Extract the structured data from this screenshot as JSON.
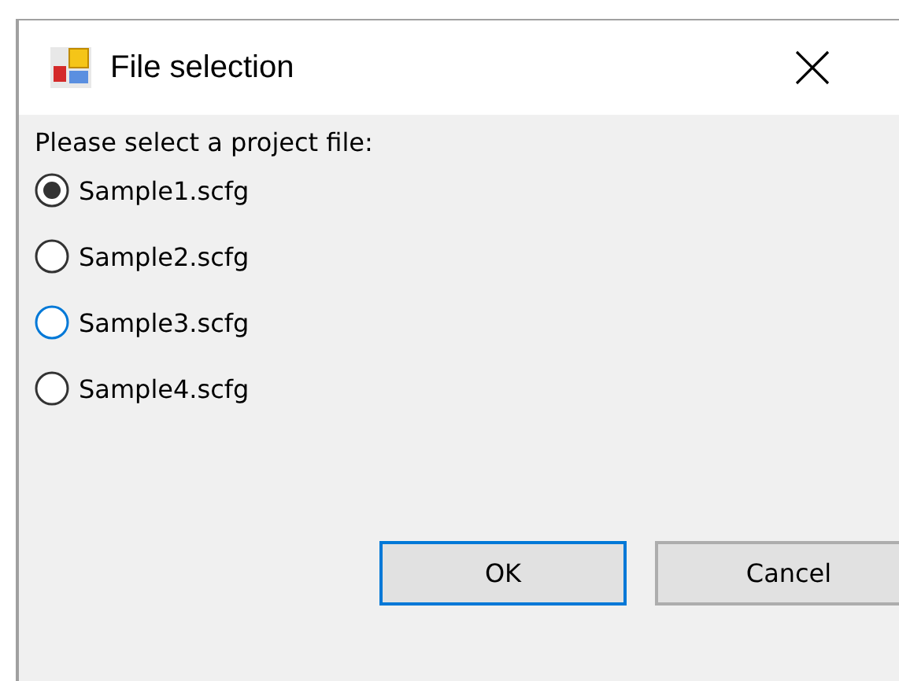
{
  "window": {
    "title": "File selection"
  },
  "prompt": "Please select a project file:",
  "options": [
    {
      "label": "Sample1.scfg",
      "selected": true,
      "hovered": false
    },
    {
      "label": "Sample2.scfg",
      "selected": false,
      "hovered": false
    },
    {
      "label": "Sample3.scfg",
      "selected": false,
      "hovered": true
    },
    {
      "label": "Sample4.scfg",
      "selected": false,
      "hovered": false
    }
  ],
  "buttons": [
    {
      "label": "OK",
      "default": true
    },
    {
      "label": "Cancel",
      "default": false
    }
  ]
}
